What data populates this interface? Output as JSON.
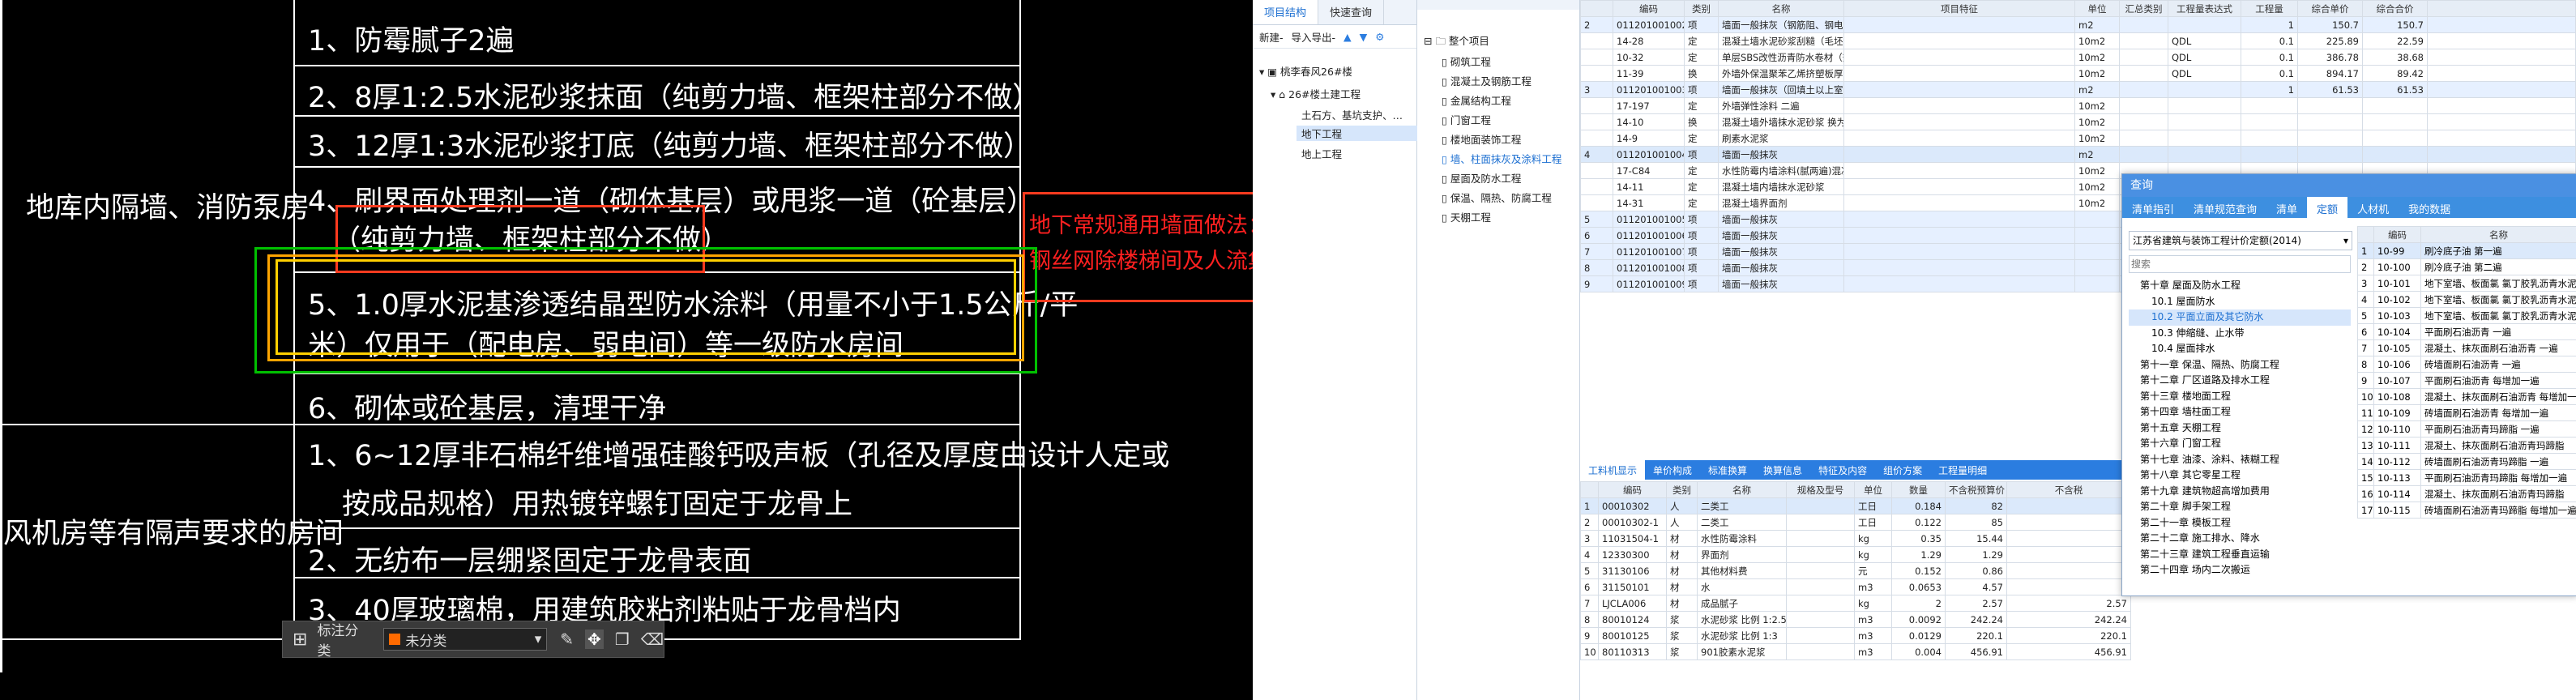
{
  "cad": {
    "left_label_1": "地库内隔墙、消防泵房",
    "left_label_2": "风机房等有隔声要求的房间",
    "rows": [
      "1、防霉腻子2遍",
      "2、8厚1:2.5水泥砂浆抹面（纯剪力墙、框架柱部分不做）",
      "3、12厚1:3水泥砂浆打底（纯剪力墙、框架柱部分不做）",
      "4、刷界面处理剂一道（砌体基层）或甩浆一道（砼基层）",
      "（纯剪力墙、框架柱部分不做）",
      "5、1.0厚水泥基渗透结晶型防水涂料（用量不小于1.5公斤/平",
      "米）仅用于（配电房、弱电间）等一级防水房间",
      "6、砌体或砼基层，清理干净",
      "1、6~12厚非石棉纤维增强硅酸钙吸声板（孔径及厚度由设计人定或",
      "按成品规格）用热镀锌螺钉固定于龙骨上",
      "2、无纺布一层绷紧固定于龙骨表面",
      "3、40厚玻璃棉，用建筑胶粘剂粘贴于龙骨档内"
    ],
    "red_note_1": "地下常规通用墙面做法：",
    "red_note_2": "钢丝网除楼梯间及人流集",
    "toolbar": {
      "label": "标注分类",
      "category": "未分类"
    }
  },
  "project": {
    "tabs": [
      "项目结构",
      "快速查询"
    ],
    "toolbar": [
      "新建-",
      "导入导出-"
    ],
    "tree": [
      "桃李春风26#楼",
      "26#楼土建工程",
      "土石方、基坑支护、…",
      "地下工程",
      "地上工程"
    ]
  },
  "sections": {
    "root": "整个项目",
    "items": [
      "砌筑工程",
      "混凝土及钢筋工程",
      "金属结构工程",
      "门窗工程",
      "楼地面装饰工程",
      "墙、柱面抹灰及涂料工程",
      "屋面及防水工程",
      "保温、隔热、防腐工程",
      "天棚工程"
    ]
  },
  "bill": {
    "headers": [
      "编码",
      "类别",
      "名称",
      "项目特征",
      "单位",
      "汇总类别",
      "工程量表达式",
      "工程量",
      "综合单价",
      "综合合价"
    ],
    "rows": [
      {
        "no": "2",
        "code": "011201001002",
        "type": "项",
        "name": "墙面一般抹灰（钢筋阻、钢电间与土楼板的外墙）",
        "unit": "m2",
        "expr": "",
        "qty": "1",
        "price": "150.7",
        "total": "150.7"
      },
      {
        "no": "",
        "code": "14-28",
        "type": "定",
        "name": "混凝土墙水泥砂浆刮糙（毛坯）",
        "unit": "10m2",
        "expr": "QDL",
        "qty": "0.1",
        "price": "225.89",
        "total": "22.59"
      },
      {
        "no": "",
        "code": "10-32",
        "type": "定",
        "name": "单层SBS改性沥青防水卷材（热熔满铺法）（4厚）",
        "unit": "10m2",
        "expr": "QDL",
        "qty": "0.1",
        "price": "386.78",
        "total": "38.68"
      },
      {
        "no": "",
        "code": "11-39",
        "type": "换",
        "name": "外墙外保温聚苯乙烯挤塑板厚度25mm 粘接面 实际厚度(mm):30",
        "unit": "10m2",
        "expr": "QDL",
        "qty": "0.1",
        "price": "894.17",
        "total": "89.42"
      },
      {
        "no": "3",
        "code": "011201001003",
        "type": "项",
        "name": "墙面一般抹灰（回填土以上室内墙面）",
        "unit": "m2",
        "expr": "",
        "qty": "1",
        "price": "61.53",
        "total": "61.53"
      },
      {
        "no": "",
        "code": "17-197",
        "type": "定",
        "name": "外墙弹性涂料 二遍",
        "unit": "10m2",
        "expr": "",
        "qty": "",
        "price": "",
        "total": ""
      },
      {
        "no": "",
        "code": "14-10",
        "type": "换",
        "name": "混凝土墙外墙抹水泥砂浆 换为【水泥砂浆 比例 1:3】",
        "unit": "10m2",
        "expr": "",
        "qty": "",
        "price": "",
        "total": ""
      },
      {
        "no": "",
        "code": "14-9",
        "type": "定",
        "name": "刷素水泥浆",
        "unit": "10m2",
        "expr": "",
        "qty": "",
        "price": "",
        "total": ""
      },
      {
        "no": "4",
        "code": "011201001004",
        "type": "项",
        "name": "墙面一般抹灰",
        "unit": "m2",
        "expr": "",
        "qty": "",
        "price": "",
        "total": ""
      },
      {
        "no": "",
        "code": "17-C84",
        "type": "定",
        "name": "水性防霉内墙涂料(腻两遍)混凝土面 两刮腻子",
        "unit": "10m2",
        "expr": "",
        "qty": "",
        "price": "",
        "total": ""
      },
      {
        "no": "",
        "code": "14-11",
        "type": "定",
        "name": "混凝土墙内墙抹水泥砂浆",
        "unit": "10m2",
        "expr": "",
        "qty": "",
        "price": "",
        "total": ""
      },
      {
        "no": "",
        "code": "14-31",
        "type": "定",
        "name": "混凝土墙界面剂",
        "unit": "10m2",
        "expr": "",
        "qty": "",
        "price": "",
        "total": ""
      },
      {
        "no": "5",
        "code": "011201001005",
        "type": "项",
        "name": "墙面一般抹灰",
        "unit": "",
        "expr": "",
        "qty": "",
        "price": "",
        "total": ""
      },
      {
        "no": "6",
        "code": "011201001006",
        "type": "项",
        "name": "墙面一般抹灰",
        "unit": "",
        "expr": "",
        "qty": "",
        "price": "",
        "total": ""
      },
      {
        "no": "7",
        "code": "011201001007",
        "type": "项",
        "name": "墙面一般抹灰",
        "unit": "",
        "expr": "",
        "qty": "",
        "price": "",
        "total": ""
      },
      {
        "no": "8",
        "code": "011201001008",
        "type": "项",
        "name": "墙面一般抹灰",
        "unit": "",
        "expr": "",
        "qty": "",
        "price": "",
        "total": ""
      },
      {
        "no": "9",
        "code": "011201001009",
        "type": "项",
        "name": "墙面一般抹灰",
        "unit": "",
        "expr": "",
        "qty": "",
        "price": "",
        "total": ""
      }
    ]
  },
  "materials": {
    "tabs": [
      "工料机显示",
      "单价构成",
      "标准换算",
      "换算信息",
      "特征及内容",
      "组价方案",
      "工程量明细"
    ],
    "headers": [
      "编码",
      "类别",
      "名称",
      "规格及型号",
      "单位",
      "数量",
      "不含税预算价",
      "不含税"
    ],
    "rows": [
      {
        "no": "1",
        "code": "00010302",
        "type": "人",
        "name": "二类工",
        "spec": "",
        "unit": "工日",
        "qty": "0.184",
        "price": "82",
        "p2": ""
      },
      {
        "no": "2",
        "code": "00010302-1",
        "type": "人",
        "name": "二类工",
        "spec": "",
        "unit": "工日",
        "qty": "0.122",
        "price": "85",
        "p2": ""
      },
      {
        "no": "3",
        "code": "11031504-1",
        "type": "材",
        "name": "水性防霉涂料",
        "spec": "",
        "unit": "kg",
        "qty": "0.35",
        "price": "15.44",
        "p2": ""
      },
      {
        "no": "4",
        "code": "12330300",
        "type": "材",
        "name": "界面剂",
        "spec": "",
        "unit": "kg",
        "qty": "1.29",
        "price": "1.29",
        "p2": ""
      },
      {
        "no": "5",
        "code": "31130106",
        "type": "材",
        "name": "其他材料费",
        "spec": "",
        "unit": "元",
        "qty": "0.152",
        "price": "0.86",
        "p2": ""
      },
      {
        "no": "6",
        "code": "31150101",
        "type": "材",
        "name": "水",
        "spec": "",
        "unit": "m3",
        "qty": "0.0653",
        "price": "4.57",
        "p2": ""
      },
      {
        "no": "7",
        "code": "LJCLA006",
        "type": "材",
        "name": "成品腻子",
        "spec": "",
        "unit": "kg",
        "qty": "2",
        "price": "2.57",
        "p2": "2.57"
      },
      {
        "no": "8",
        "code": "80010124",
        "type": "浆",
        "name": "水泥砂浆 比例 1:2.5",
        "spec": "",
        "unit": "m3",
        "qty": "0.0092",
        "price": "242.24",
        "p2": "242.24"
      },
      {
        "no": "9",
        "code": "80010125",
        "type": "浆",
        "name": "水泥砂浆 比例 1:3",
        "spec": "",
        "unit": "m3",
        "qty": "0.0129",
        "price": "220.1",
        "p2": "220.1"
      },
      {
        "no": "10",
        "code": "80110313",
        "type": "浆",
        "name": "901胶素水泥浆",
        "spec": "",
        "unit": "m3",
        "qty": "0.004",
        "price": "456.91",
        "p2": "456.91"
      }
    ]
  },
  "query_dialog": {
    "title": "查询",
    "tabs": [
      "清单指引",
      "清单规范查询",
      "清单",
      "定额",
      "人材机",
      "我的数据"
    ],
    "library": "江苏省建筑与装饰工程计价定额(2014)",
    "search_placeholder": "搜索",
    "tree": [
      "第十章 屋面及防水工程",
      "10.1 屋面防水",
      "10.2 平面立面及其它防水",
      "10.3 伸缩缝、止水带",
      "10.4 屋面排水",
      "第十一章 保温、隔热、防腐工程",
      "第十二章 厂区道路及排水工程",
      "第十三章 楼地面工程",
      "第十四章 墙柱面工程",
      "第十五章 天棚工程",
      "第十六章 门窗工程",
      "第十七章 油漆、涂料、裱糊工程",
      "第十八章 其它零星工程",
      "第十九章 建筑物超高增加费用",
      "第二十章 脚手架工程",
      "第二十一章 模板工程",
      "第二十二章 施工排水、降水",
      "第二十三章 建筑工程垂直运输",
      "第二十四章 场内二次搬运"
    ],
    "grid_headers": [
      "编码",
      "名称"
    ],
    "grid_rows": [
      {
        "no": "1",
        "code": "10-99",
        "name": "刷冷底子油 第一遍"
      },
      {
        "no": "2",
        "code": "10-100",
        "name": "刷冷底子油 第二遍"
      },
      {
        "no": "3",
        "code": "10-101",
        "name": "地下室墙、板面氯 氯丁胶乳沥青水泥砂浆"
      },
      {
        "no": "4",
        "code": "10-102",
        "name": "地下室墙、板面氯 氯丁胶乳沥青水泥砂浆"
      },
      {
        "no": "5",
        "code": "10-103",
        "name": "地下室墙、板面氯 氯丁胶乳沥青水泥砂浆"
      },
      {
        "no": "6",
        "code": "10-104",
        "name": "平面刷石油沥青 一遍"
      },
      {
        "no": "7",
        "code": "10-105",
        "name": "混凝土、抹灰面刷石油沥青 一遍"
      },
      {
        "no": "8",
        "code": "10-106",
        "name": "砖墙面刷石油沥青 一遍"
      },
      {
        "no": "9",
        "code": "10-107",
        "name": "平面刷石油沥青 每增加一遍"
      },
      {
        "no": "10",
        "code": "10-108",
        "name": "混凝土、抹灰面刷石油沥青 每增加一遍"
      },
      {
        "no": "11",
        "code": "10-109",
        "name": "砖墙面刷石油沥青 每增加一遍"
      },
      {
        "no": "12",
        "code": "10-110",
        "name": "平面刷石油沥青玛蹄脂 一遍"
      },
      {
        "no": "13",
        "code": "10-111",
        "name": "混凝土、抹灰面刷石油沥青玛蹄脂"
      },
      {
        "no": "14",
        "code": "10-112",
        "name": "砖墙面刷石油沥青玛蹄脂 一遍"
      },
      {
        "no": "15",
        "code": "10-113",
        "name": "平面刷石油沥青玛蹄脂 每增加一遍"
      },
      {
        "no": "16",
        "code": "10-114",
        "name": "混凝土、抹灰面刷石油沥青玛蹄脂"
      },
      {
        "no": "17",
        "code": "10-115",
        "name": "砖墙面刷石油沥青玛蹄脂 每增加一遍"
      }
    ]
  }
}
